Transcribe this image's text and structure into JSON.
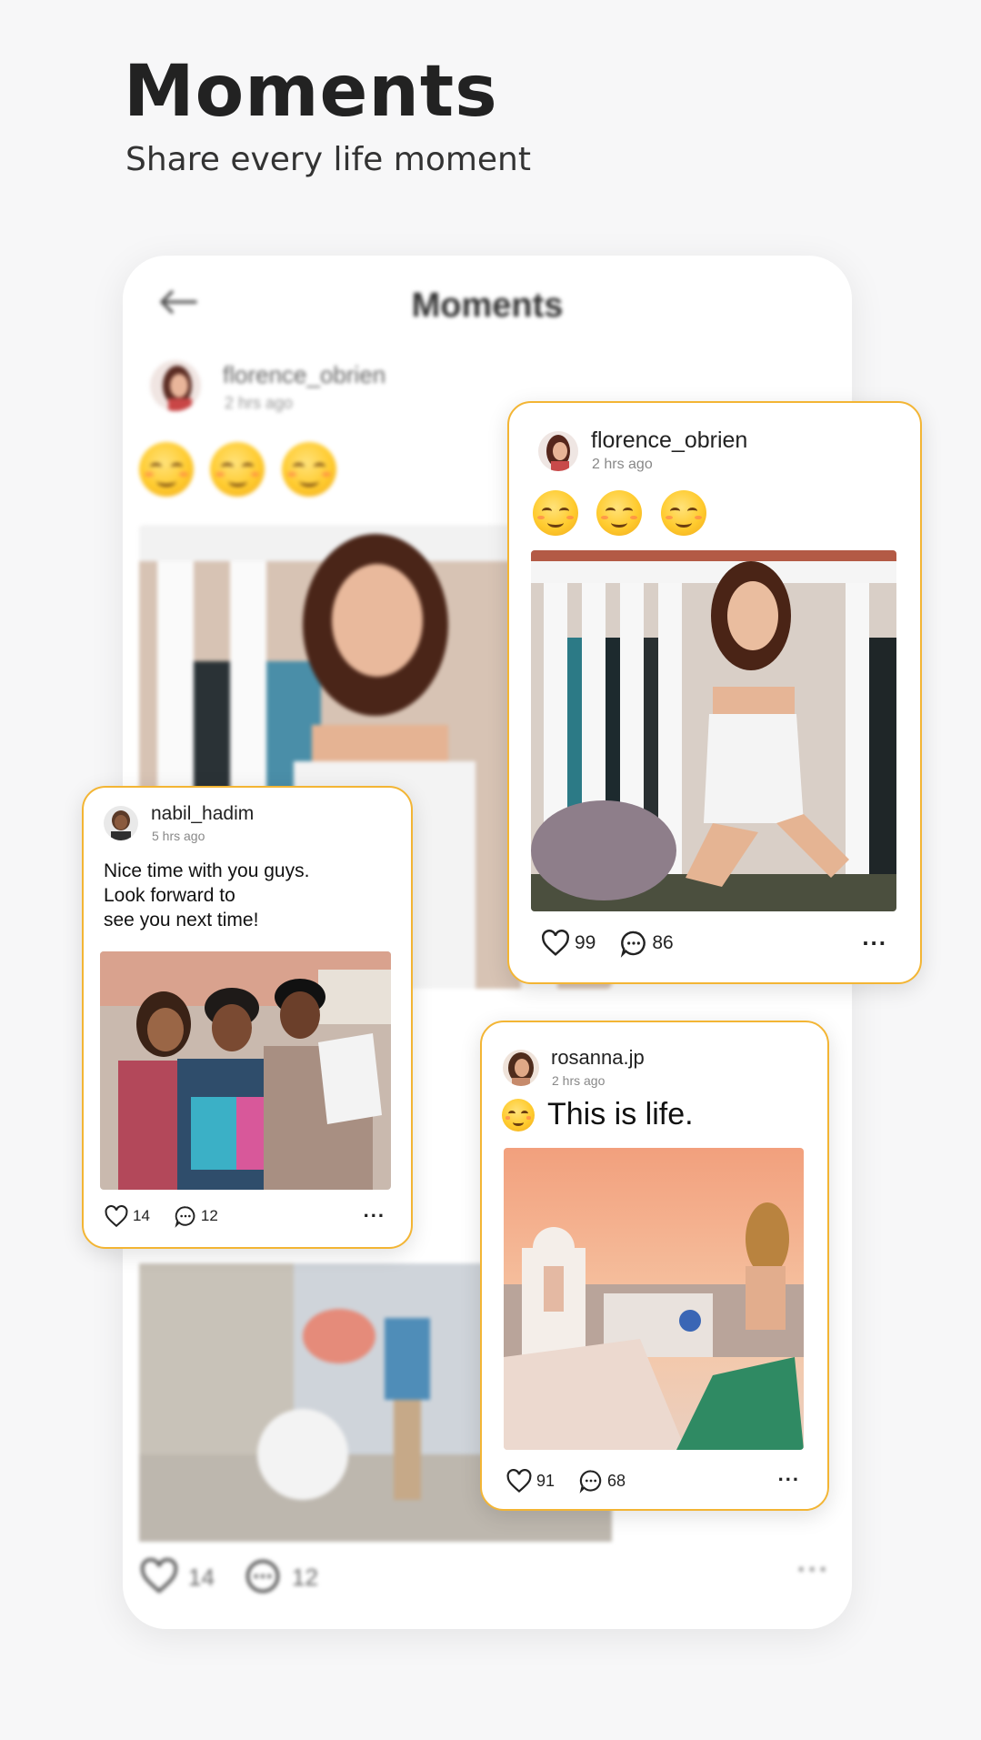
{
  "hero": {
    "title": "Moments",
    "subtitle": "Share every life moment"
  },
  "background_screen": {
    "title": "Moments",
    "back_icon": "arrow-left-icon",
    "post1": {
      "username": "florence_obrien",
      "time": "2 hrs ago",
      "emojis": [
        "smiling-blush",
        "smiling-blush",
        "smiling-blush"
      ]
    },
    "post2": {
      "likes": "14",
      "comments": "12"
    }
  },
  "cards": {
    "florence": {
      "username": "florence_obrien",
      "time": "2 hrs ago",
      "emojis": [
        "smiling-blush",
        "smiling-blush",
        "smiling-blush"
      ],
      "likes": "99",
      "comments": "86",
      "more": "..."
    },
    "nabil": {
      "username": "nabil_hadim",
      "time": "5 hrs ago",
      "text_line1": "Nice time with you guys.",
      "text_line2": "Look forward to",
      "text_line3": "see you next time!",
      "likes": "14",
      "comments": "12",
      "more": "..."
    },
    "rosanna": {
      "username": "rosanna.jp",
      "time": "2 hrs ago",
      "caption": "This is life.",
      "likes": "91",
      "comments": "68",
      "more": "..."
    }
  },
  "colors": {
    "accent_border": "#f3b534",
    "background": "#f7f7f8",
    "card_background": "#ffffff"
  }
}
